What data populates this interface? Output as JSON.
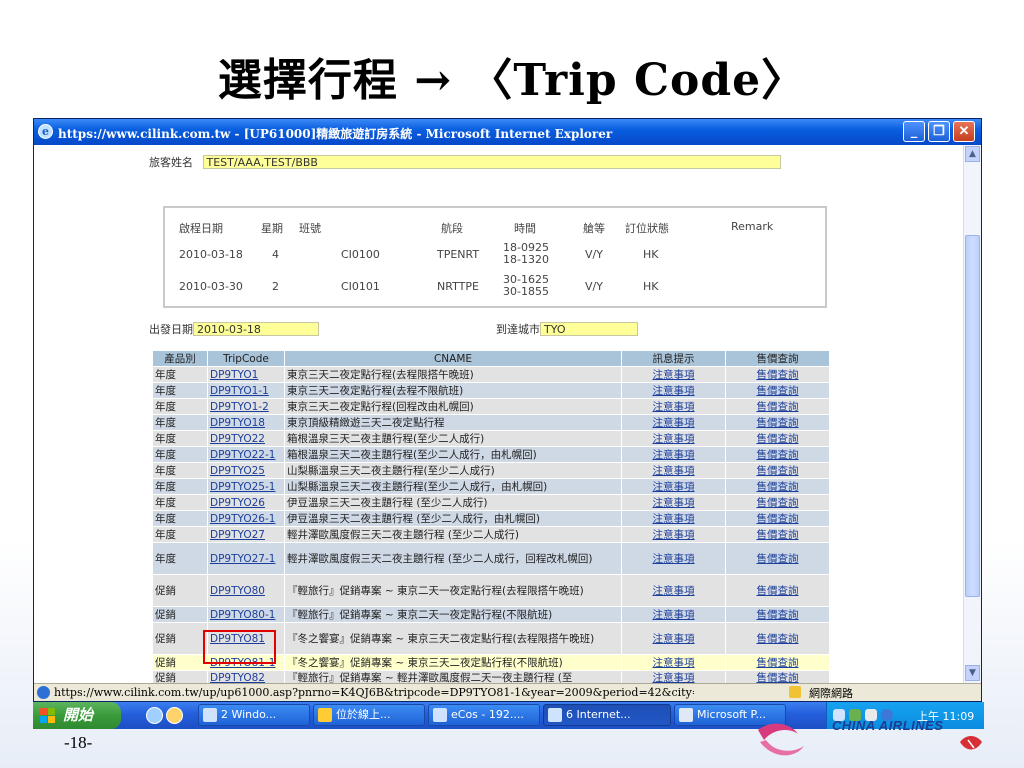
{
  "slide": {
    "title": "選擇行程 → 〈Trip Code〉",
    "page_number": "-18-",
    "logo_text": "CHINA AIRLINES"
  },
  "window": {
    "title": "https://www.cilink.com.tw - [UP61000]精緻旅遊訂房系統 - Microsoft Internet Explorer",
    "buttons": {
      "minimize": "_",
      "maximize": "❐",
      "close": "✕"
    },
    "status_url": "https://www.cilink.com.tw/up/up61000.asp?pnrno=K4QJ6B&tripcode=DP9TYO81-1&year=2009&period=42&city=",
    "status_zone": "網際網路"
  },
  "passenger": {
    "label": "旅客姓名",
    "value": "TEST/AAA,TEST/BBB"
  },
  "flights": {
    "headers": [
      "啟程日期",
      "星期",
      "班號",
      "航段",
      "時間",
      "艙等",
      "訂位狀態",
      "Remark"
    ],
    "rows": [
      {
        "date": "2010-03-18",
        "weekday": "4",
        "flight": "CI0100",
        "sector": "TPENRT",
        "time1": "18-0925",
        "time2": "18-1320",
        "class": "V/Y",
        "status": "HK"
      },
      {
        "date": "2010-03-30",
        "weekday": "2",
        "flight": "CI0101",
        "sector": "NRTTPE",
        "time1": "30-1625",
        "time2": "30-1855",
        "class": "V/Y",
        "status": "HK"
      }
    ]
  },
  "search": {
    "depart_label": "出發日期",
    "depart_value": "2010-03-18",
    "city_label": "到達城市",
    "city_value": "TYO"
  },
  "trips": {
    "headers": [
      "產品別",
      "TripCode",
      "CNAME",
      "訊息提示",
      "售價查詢"
    ],
    "rows": [
      {
        "type": "年度",
        "code": "DP9TYO1",
        "name": "東京三天二夜定點行程(去程限搭午晚班)",
        "notice": "注意事項",
        "price": "售價查詢"
      },
      {
        "type": "年度",
        "code": "DP9TYO1-1",
        "name": "東京三天二夜定點行程(去程不限航班)",
        "notice": "注意事項",
        "price": "售價查詢"
      },
      {
        "type": "年度",
        "code": "DP9TYO1-2",
        "name": "東京三天二夜定點行程(回程改由札幌回)",
        "notice": "注意事項",
        "price": "售價查詢"
      },
      {
        "type": "年度",
        "code": "DP9TYO18",
        "name": "東京頂級精緻遊三天二夜定點行程",
        "notice": "注意事項",
        "price": "售價查詢"
      },
      {
        "type": "年度",
        "code": "DP9TYO22",
        "name": "箱根溫泉三天二夜主題行程(至少二人成行)",
        "notice": "注意事項",
        "price": "售價查詢"
      },
      {
        "type": "年度",
        "code": "DP9TYO22-1",
        "name": "箱根溫泉三天二夜主題行程(至少二人成行，由札幌回)",
        "notice": "注意事項",
        "price": "售價查詢"
      },
      {
        "type": "年度",
        "code": "DP9TYO25",
        "name": "山梨縣溫泉三天二夜主題行程(至少二人成行)",
        "notice": "注意事項",
        "price": "售價查詢"
      },
      {
        "type": "年度",
        "code": "DP9TYO25-1",
        "name": "山梨縣溫泉三天二夜主題行程(至少二人成行，由札幌回)",
        "notice": "注意事項",
        "price": "售價查詢"
      },
      {
        "type": "年度",
        "code": "DP9TYO26",
        "name": "伊豆溫泉三天二夜主題行程 (至少二人成行)",
        "notice": "注意事項",
        "price": "售價查詢"
      },
      {
        "type": "年度",
        "code": "DP9TYO26-1",
        "name": "伊豆溫泉三天二夜主題行程 (至少二人成行，由札幌回)",
        "notice": "注意事項",
        "price": "售價查詢"
      },
      {
        "type": "年度",
        "code": "DP9TYO27",
        "name": "輕井澤歐風度假三天二夜主題行程 (至少二人成行)",
        "notice": "注意事項",
        "price": "售價查詢"
      },
      {
        "type": "年度",
        "code": "DP9TYO27-1",
        "name": "輕井澤歐風度假三天二夜主題行程 (至少二人成行，回程改札幌回)",
        "notice": "注意事項",
        "price": "售價查詢"
      },
      {
        "type": "促銷",
        "code": "DP9TYO80",
        "name": "『輕旅行』促銷專案 ~ 東京二天一夜定點行程(去程限搭午晚班)",
        "notice": "注意事項",
        "price": "售價查詢"
      },
      {
        "type": "促銷",
        "code": "DP9TYO80-1",
        "name": "『輕旅行』促銷專案 ~ 東京二天一夜定點行程(不限航班)",
        "notice": "注意事項",
        "price": "售價查詢"
      },
      {
        "type": "促銷",
        "code": "DP9TYO81",
        "name": "『冬之饗宴』促銷專案 ~ 東京三天二夜定點行程(去程限搭午晚班)",
        "notice": "注意事項",
        "price": "售價查詢"
      },
      {
        "type": "促銷",
        "code": "DP9TYO81-1",
        "name": "『冬之饗宴』促銷專案 ~ 東京三天二夜定點行程(不限航班)",
        "notice": "注意事項",
        "price": "售價查詢"
      },
      {
        "type": "促銷",
        "code": "DP9TYO82",
        "name": "『輕旅行』促銷專案 ~ 輕井澤歐風度假二天一夜主題行程 (至",
        "notice": "注意事項",
        "price": "售價查詢"
      }
    ]
  },
  "taskbar": {
    "start": "開始",
    "items": [
      "2 Windo...",
      "位於線上...",
      "eCos - 192....",
      "6 Internet...",
      "Microsoft P..."
    ],
    "clock": "上午 11:09"
  }
}
